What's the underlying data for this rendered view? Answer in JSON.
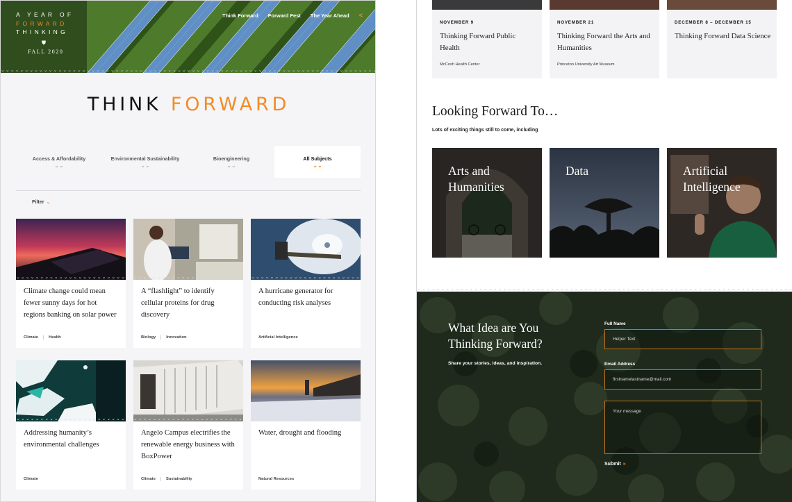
{
  "logo": {
    "line1": "A YEAR OF",
    "line2": "FORWARD",
    "line3": "THINKING",
    "mark_icon": "princeton-shield-icon",
    "season": "FALL 2020"
  },
  "nav": {
    "items": [
      {
        "label": "Think Forward"
      },
      {
        "label": "Forward Fest"
      },
      {
        "label": "The Year Ahead"
      }
    ],
    "share_icon": "share-icon"
  },
  "wordmark": {
    "part1": "THINK",
    "part2": "FORWARD"
  },
  "subjects": {
    "items": [
      {
        "label": "Access & Affordability"
      },
      {
        "label": "Environmental Sustainability"
      },
      {
        "label": "Bioengineering"
      },
      {
        "label": "All Subjects"
      }
    ],
    "selected": "All Subjects"
  },
  "filter": {
    "label": "Filter"
  },
  "cards": [
    {
      "title": "Climate change could mean fewer sunny days for hot regions banking on solar power",
      "tags": [
        "Climate",
        "Health"
      ]
    },
    {
      "title": "A “flashlight” to identify cellular proteins for drug discovery",
      "tags": [
        "Biology",
        "Innovation"
      ]
    },
    {
      "title": "A hurricane generator for conducting risk analyses",
      "tags": [
        "Artificial Intelligence"
      ]
    },
    {
      "title": "Addressing humanity’s environmental challenges",
      "tags": [
        "Climate"
      ]
    },
    {
      "title": "Angelo Campus electrifies the renewable energy business with BoxPower",
      "tags": [
        "Climate",
        "Sustainability"
      ]
    },
    {
      "title": "Water, drought and flooding",
      "tags": [
        "Natural Resources"
      ]
    }
  ],
  "events": [
    {
      "date": "NOVEMBER 9",
      "title": "Thinking Forward Public Health",
      "venue": "McCosh Health Center"
    },
    {
      "date": "NOVEMBER 21",
      "title": "Thinking Forward the Arts and Humanities",
      "venue": "Princeton University Art Museum"
    },
    {
      "date": "DECEMBER 8 – DECEMBER 15",
      "title": "Thinking Forward Data Science",
      "venue": ""
    }
  ],
  "looking_forward": {
    "heading": "Looking Forward To…",
    "subheading": "Lots of exciting things still to come, including",
    "topics": [
      {
        "label_line1": "Arts and",
        "label_line2": "Humanities"
      },
      {
        "label_line1": "Data",
        "label_line2": ""
      },
      {
        "label_line1": "Artificial",
        "label_line2": "Intelligence"
      }
    ]
  },
  "form": {
    "heading_line1": "What Idea are You",
    "heading_line2": "Thinking Forward?",
    "subheading": "Share your stories, ideas, and inspiration.",
    "full_name_label": "Full Name",
    "full_name_placeholder": "Helper Text",
    "email_label": "Email Address",
    "email_placeholder": "firstnamelastname@mail.com",
    "message_placeholder": "Your message",
    "submit_label": "Submit"
  },
  "colors": {
    "accent": "#f28c28",
    "form_border": "#c7741b",
    "forest": "#1f2a1c"
  }
}
